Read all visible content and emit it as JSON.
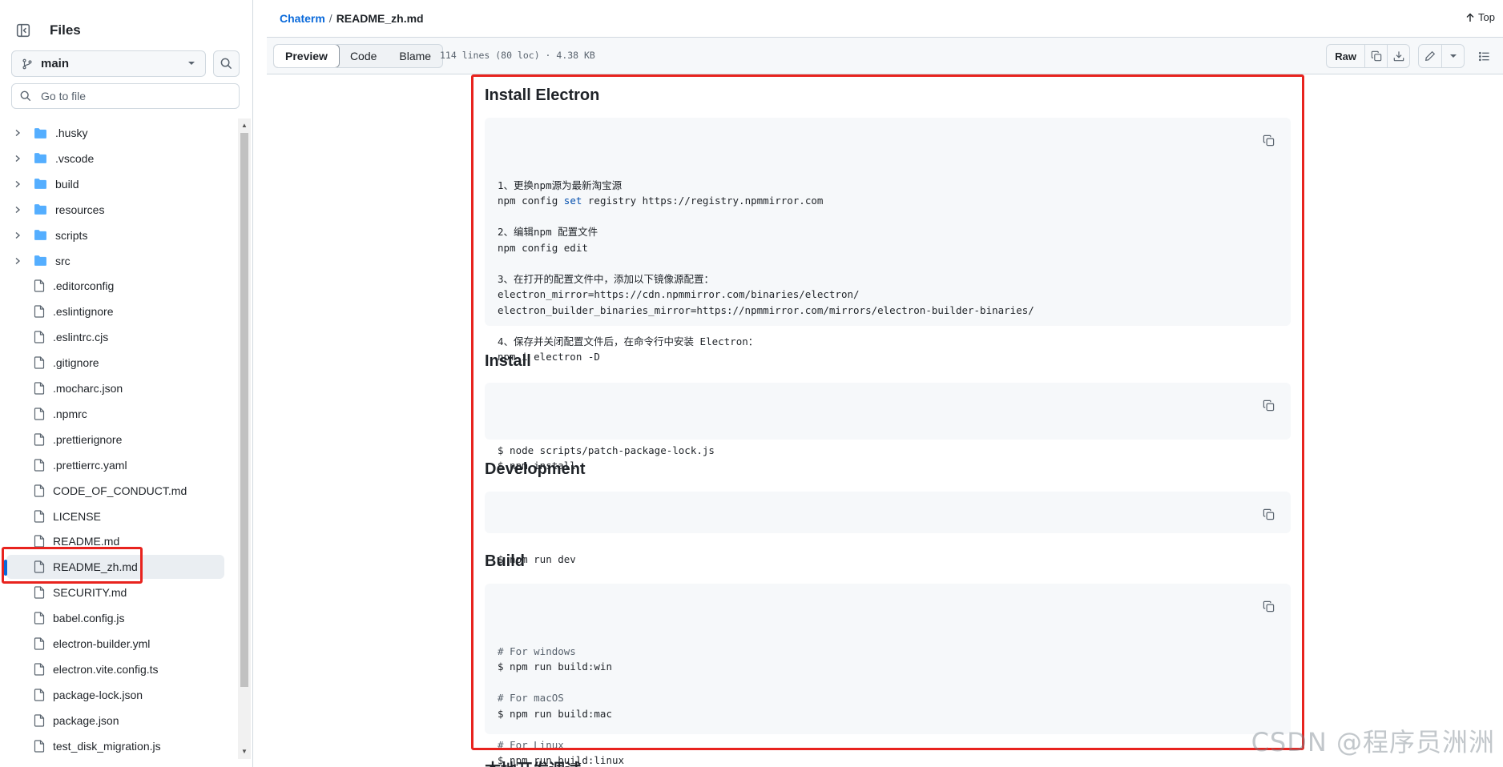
{
  "sidebar": {
    "title": "Files",
    "branch": "main",
    "goto_placeholder": "Go to file",
    "items": [
      {
        "name": ".husky",
        "type": "folder"
      },
      {
        "name": ".vscode",
        "type": "folder"
      },
      {
        "name": "build",
        "type": "folder"
      },
      {
        "name": "resources",
        "type": "folder"
      },
      {
        "name": "scripts",
        "type": "folder"
      },
      {
        "name": "src",
        "type": "folder"
      },
      {
        "name": ".editorconfig",
        "type": "file"
      },
      {
        "name": ".eslintignore",
        "type": "file"
      },
      {
        "name": ".eslintrc.cjs",
        "type": "file"
      },
      {
        "name": ".gitignore",
        "type": "file"
      },
      {
        "name": ".mocharc.json",
        "type": "file"
      },
      {
        "name": ".npmrc",
        "type": "file"
      },
      {
        "name": ".prettierignore",
        "type": "file"
      },
      {
        "name": ".prettierrc.yaml",
        "type": "file"
      },
      {
        "name": "CODE_OF_CONDUCT.md",
        "type": "file"
      },
      {
        "name": "LICENSE",
        "type": "file"
      },
      {
        "name": "README.md",
        "type": "file"
      },
      {
        "name": "README_zh.md",
        "type": "file",
        "selected": true
      },
      {
        "name": "SECURITY.md",
        "type": "file"
      },
      {
        "name": "babel.config.js",
        "type": "file"
      },
      {
        "name": "electron-builder.yml",
        "type": "file"
      },
      {
        "name": "electron.vite.config.ts",
        "type": "file"
      },
      {
        "name": "package-lock.json",
        "type": "file"
      },
      {
        "name": "package.json",
        "type": "file"
      },
      {
        "name": "test_disk_migration.js",
        "type": "file"
      }
    ]
  },
  "breadcrumb": {
    "repo": "Chaterm",
    "separator": "/",
    "file": "README_zh.md"
  },
  "top_link": "Top",
  "view_tabs": [
    "Preview",
    "Code",
    "Blame"
  ],
  "file_info": "114 lines (80 loc) · 4.38 KB",
  "toolbar": {
    "raw_label": "Raw"
  },
  "markdown": {
    "sections": [
      {
        "heading": "Install Electron",
        "code": [
          "1、更换npm源为最新淘宝源",
          "npm config set registry https://registry.npmmirror.com",
          "",
          "2、编辑npm 配置文件",
          "npm config edit",
          "",
          "3、在打开的配置文件中，添加以下镜像源配置：",
          "electron_mirror=https://cdn.npmmirror.com/binaries/electron/",
          "electron_builder_binaries_mirror=https://npmmirror.com/mirrors/electron-builder-binaries/",
          "",
          "4、保存并关闭配置文件后，在命令行中安装 Electron：",
          "npm i electron -D"
        ]
      },
      {
        "heading": "Install",
        "code": [
          "$ node scripts/patch-package-lock.js",
          "$ npm install"
        ]
      },
      {
        "heading": "Development",
        "code": [
          "$ npm run dev"
        ]
      },
      {
        "heading": "Build",
        "code": [
          "# For windows",
          "$ npm run build:win",
          "",
          "# For macOS",
          "$ npm run build:mac",
          "",
          "# For Linux",
          "$ npm run build:linux"
        ]
      }
    ],
    "next_heading_partial": "本地开发调试"
  },
  "watermark": "CSDN @程序员洲洲",
  "colors": {
    "accent": "#0969da",
    "highlight": "#e8231e",
    "folder": "#54aeff"
  }
}
